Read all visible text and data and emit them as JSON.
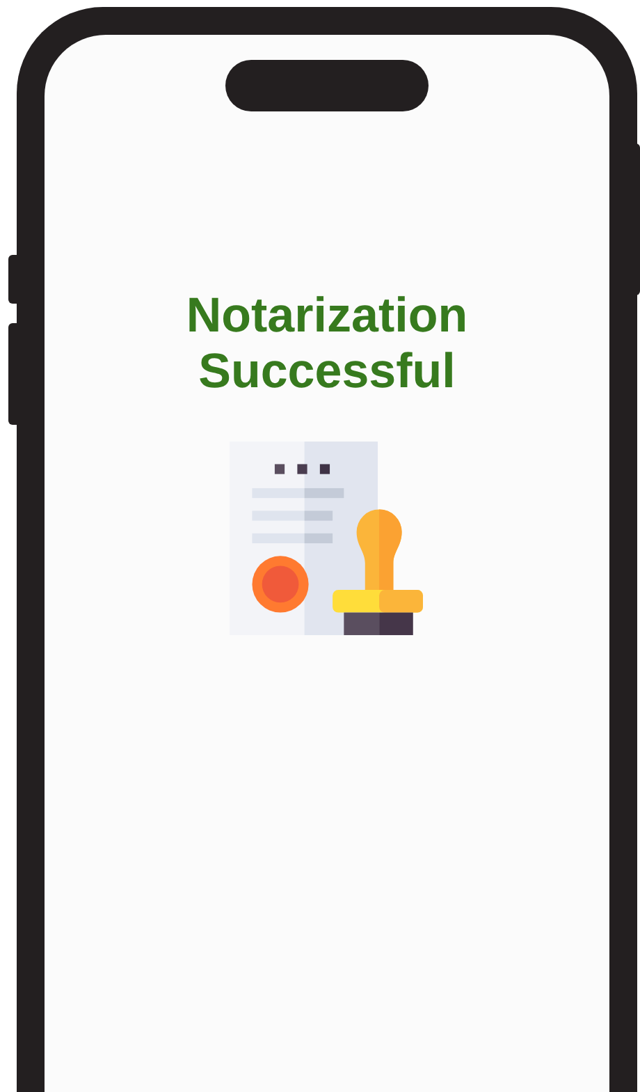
{
  "screen": {
    "title": "Notarization Successful"
  }
}
